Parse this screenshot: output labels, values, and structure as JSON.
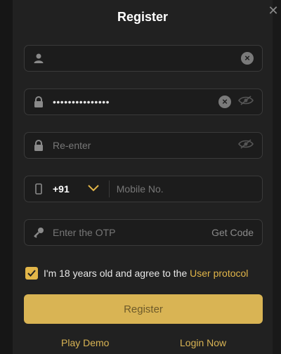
{
  "title": "Register",
  "username": {
    "value": "",
    "placeholder": ""
  },
  "password": {
    "masked_value": "•••••••••••••••"
  },
  "reenter": {
    "placeholder": "Re-enter"
  },
  "mobile": {
    "country_code": "+91",
    "placeholder": "Mobile No."
  },
  "otp": {
    "placeholder": "Enter the OTP",
    "get_code_label": "Get Code"
  },
  "agreement": {
    "text": "I'm 18 years old and agree to the ",
    "link": "User protocol",
    "checked": true
  },
  "register_button": "Register",
  "links": {
    "play_demo": "Play Demo",
    "login_now": "Login Now"
  },
  "colors": {
    "accent": "#e2b649",
    "background": "#212121"
  }
}
